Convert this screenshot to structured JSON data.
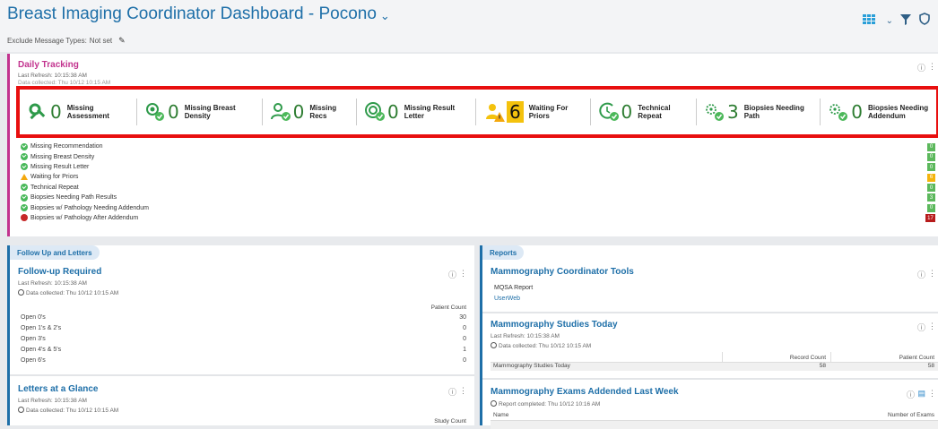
{
  "header": {
    "title": "Breast Imaging Coordinator Dashboard - Pocono",
    "caret": "⌄",
    "exclude_label": "Exclude Message Types:",
    "exclude_value": "Not set"
  },
  "daily": {
    "title": "Daily Tracking",
    "last_refresh": "Last Refresh: 10:15:38 AM",
    "data_collected": "Data collected: Thu 10/12 10:15 AM",
    "tiles": [
      {
        "count": "0",
        "label": "Missing Assessment",
        "icon": "wrench-gear-icon",
        "status": "ok"
      },
      {
        "count": "0",
        "label": "Missing Breast Density",
        "icon": "density-check-icon",
        "status": "ok"
      },
      {
        "count": "0",
        "label": "Missing Recs",
        "icon": "person-check-icon",
        "status": "ok"
      },
      {
        "count": "0",
        "label": "Missing Result Letter",
        "icon": "target-check-icon",
        "status": "ok"
      },
      {
        "count": "6",
        "label": "Waiting For Priors",
        "icon": "person-warning-icon",
        "status": "warn"
      },
      {
        "count": "0",
        "label": "Technical Repeat",
        "icon": "repeat-check-icon",
        "status": "ok"
      },
      {
        "count": "3",
        "label": "Biopsies Needing Path",
        "icon": "biopsy-check-icon",
        "status": "ok"
      },
      {
        "count": "0",
        "label": "Biopsies Needing Addendum",
        "icon": "biopsy-check-icon",
        "status": "ok"
      }
    ],
    "list": [
      {
        "label": "Missing Recommendation",
        "status": "ok",
        "count": "0"
      },
      {
        "label": "Missing Breast Density",
        "status": "ok",
        "count": "0"
      },
      {
        "label": "Missing Result Letter",
        "status": "ok",
        "count": "0"
      },
      {
        "label": "Waiting for Priors",
        "status": "warn",
        "count": "6"
      },
      {
        "label": "Technical Repeat",
        "status": "ok",
        "count": "0"
      },
      {
        "label": "Biopsies Needing Path Results",
        "status": "ok",
        "count": "3"
      },
      {
        "label": "Biopsies w/ Pathology Needing Addendum",
        "status": "ok",
        "count": "0"
      },
      {
        "label": "Biopsies w/ Pathology After Addendum",
        "status": "bad",
        "count": "17"
      }
    ]
  },
  "follow_up_section": {
    "tab": "Follow Up and Letters",
    "followup": {
      "title": "Follow-up Required",
      "last_refresh": "Last Refresh: 10:15:38 AM",
      "data_collected": "Data collected: Thu 10/12 10:15 AM",
      "col_header": "Patient Count",
      "rows": [
        {
          "label": "Open 0's",
          "value": "30"
        },
        {
          "label": "Open 1's & 2's",
          "value": "0"
        },
        {
          "label": "Open 3's",
          "value": "0"
        },
        {
          "label": "Open 4's & 5's",
          "value": "1"
        },
        {
          "label": "Open 6's",
          "value": "0"
        }
      ]
    },
    "letters": {
      "title": "Letters at a Glance",
      "last_refresh": "Last Refresh: 10:15:38 AM",
      "data_collected": "Data collected: Thu 10/12 10:15 AM",
      "col_header": "Study Count"
    }
  },
  "reports_section": {
    "tab": "Reports",
    "tools": {
      "title": "Mammography Coordinator Tools",
      "item1": "MQSA Report",
      "item2": "UserWeb"
    },
    "studies": {
      "title": "Mammography Studies Today",
      "last_refresh": "Last Refresh: 10:15:38 AM",
      "data_collected": "Data collected: Thu 10/12 10:15 AM",
      "col1": "Record Count",
      "col2": "Patient Count",
      "row_label": "Mammography Studies Today",
      "record_count": "58",
      "patient_count": "58"
    },
    "addended": {
      "title": "Mammography Exams Addended Last Week",
      "report_completed": "Report completed: Thu 10/12 10:16 AM",
      "col_name": "Name",
      "col_count": "Number of Exams"
    }
  }
}
